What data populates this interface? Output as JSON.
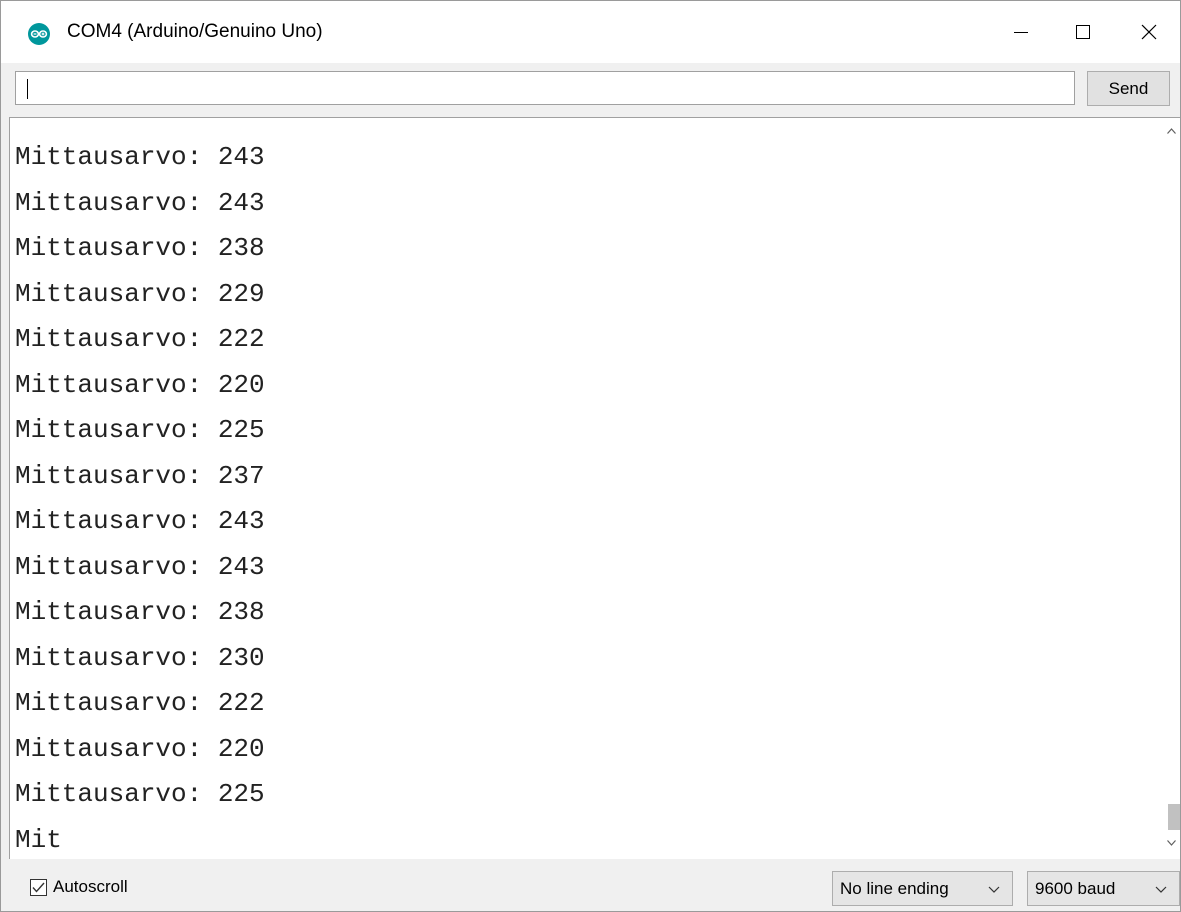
{
  "window": {
    "title": "COM4 (Arduino/Genuino Uno)",
    "app_icon": "arduino-logo-icon",
    "accent_color": "#00979c",
    "controls": [
      "minimize-icon",
      "maximize-icon",
      "close-icon"
    ]
  },
  "send": {
    "input_value": "",
    "button_label": "Send"
  },
  "output": {
    "lines": [
      "Mittausarvo: 243",
      "Mittausarvo: 243",
      "Mittausarvo: 238",
      "Mittausarvo: 229",
      "Mittausarvo: 222",
      "Mittausarvo: 220",
      "Mittausarvo: 225",
      "Mittausarvo: 237",
      "Mittausarvo: 243",
      "Mittausarvo: 243",
      "Mittausarvo: 238",
      "Mittausarvo: 230",
      "Mittausarvo: 222",
      "Mittausarvo: 220",
      "Mittausarvo: 225",
      "Mit"
    ]
  },
  "statusbar": {
    "autoscroll_label": "Autoscroll",
    "autoscroll_checked": true,
    "line_ending": "No line ending",
    "baud_rate": "9600 baud"
  }
}
